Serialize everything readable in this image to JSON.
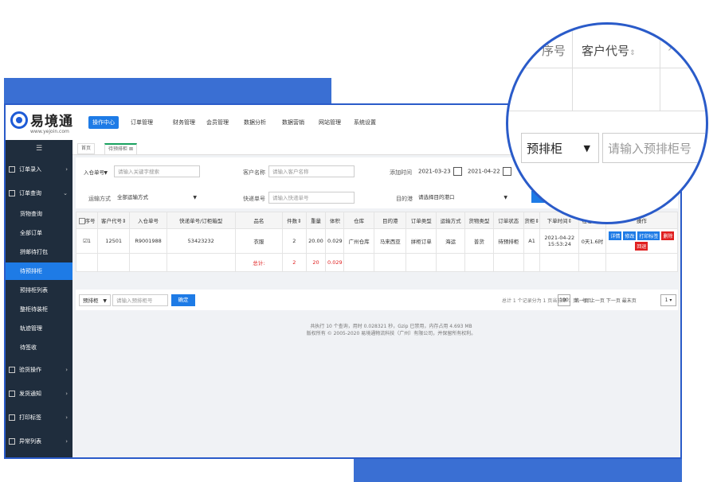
{
  "header": {
    "logo_name": "易境通",
    "logo_url": "www.yejoin.com",
    "nav": [
      "操作中心",
      "订单管理",
      "财务管理",
      "会员管理",
      "数据分析",
      "数据营销",
      "网站管理",
      "系统设置"
    ]
  },
  "sidebar": {
    "menu_icon": "☰",
    "items": [
      {
        "label": "订单录入",
        "type": "group"
      },
      {
        "label": "订单查询",
        "type": "group"
      },
      {
        "label": "货物查询",
        "type": "item"
      },
      {
        "label": "全部订单",
        "type": "item"
      },
      {
        "label": "拼邮待打包",
        "type": "item"
      },
      {
        "label": "待预排柜",
        "type": "item",
        "active": true
      },
      {
        "label": "预排柜列表",
        "type": "item"
      },
      {
        "label": "整柜待装柜",
        "type": "item"
      },
      {
        "label": "轨迹管理",
        "type": "item"
      },
      {
        "label": "待签收",
        "type": "item"
      },
      {
        "label": "验货操作",
        "type": "group"
      },
      {
        "label": "发货通知",
        "type": "group"
      },
      {
        "label": "打印标签",
        "type": "group"
      },
      {
        "label": "异常列表",
        "type": "group"
      }
    ]
  },
  "tabs": {
    "home": "首页",
    "current": "待预排柜"
  },
  "filter": {
    "order_type": "入仓单号",
    "keyword_placeholder": "请输入关键字搜索",
    "customer_label": "客户名称",
    "customer_placeholder": "请输入客户名称",
    "time_label": "添加时间",
    "date_from": "2021-03-23",
    "date_to": "2021-04-22",
    "ship_label": "运输方式",
    "ship_value": "全部运输方式",
    "express_label": "快递单号",
    "express_placeholder": "请输入快递单号",
    "port_label": "目的港",
    "port_value": "请选择目的港口",
    "search_btn": "查询"
  },
  "table": {
    "headers": [
      "序号",
      "客户代号⇕",
      "入仓单号",
      "快递单号/订柜箱型",
      "品名",
      "件数⇕",
      "重量",
      "体积",
      "仓库",
      "目的港",
      "订单类型",
      "运输方式",
      "货物类型",
      "订单状态",
      "货柜⇕",
      "下单时间⇕",
      "在仓时长",
      "操作"
    ],
    "rows": [
      [
        "1",
        "12501",
        "R9001988",
        "53423232",
        "衣服",
        "2",
        "20.00",
        "0.029",
        "广州仓库",
        "马来西亚",
        "拼柜订单",
        "海运",
        "普货",
        "待预排柜",
        "A1",
        "2021-04-22 15:53:24",
        "0天1.6时"
      ]
    ],
    "total": {
      "label": "总计:",
      "pieces": "2",
      "weight": "20",
      "volume": "0.029"
    },
    "ops": [
      "详情",
      "修改",
      "打印标签",
      "删除",
      "回退"
    ]
  },
  "bottombar": {
    "select_value": "预排柜",
    "input_placeholder": "请输入预排柜号",
    "confirm_btn": "确定",
    "summary": "总计 1 个记录分为 1 页当前第 1 页，每页",
    "page_size": "100",
    "pager": "第一页 上一页 下一页 最末页",
    "page_num": "1"
  },
  "footer": {
    "line1": "共执行 10 个查询，用时 0.028321 秒，Gzip 已禁用，内存占用 4.693 MB",
    "line2": "版权所有 © 2005-2020 易境通物流科技（广州）有限公司，并保留所有权利。"
  },
  "zoom": {
    "col1": "序号",
    "col2": "客户代号",
    "select": "预排柜",
    "placeholder": "请输入预排柜号"
  },
  "colors": {
    "accent": "#1e7be6",
    "sidebar": "#1f2d3d",
    "frame": "#2a5bc9",
    "danger": "#e02020"
  }
}
